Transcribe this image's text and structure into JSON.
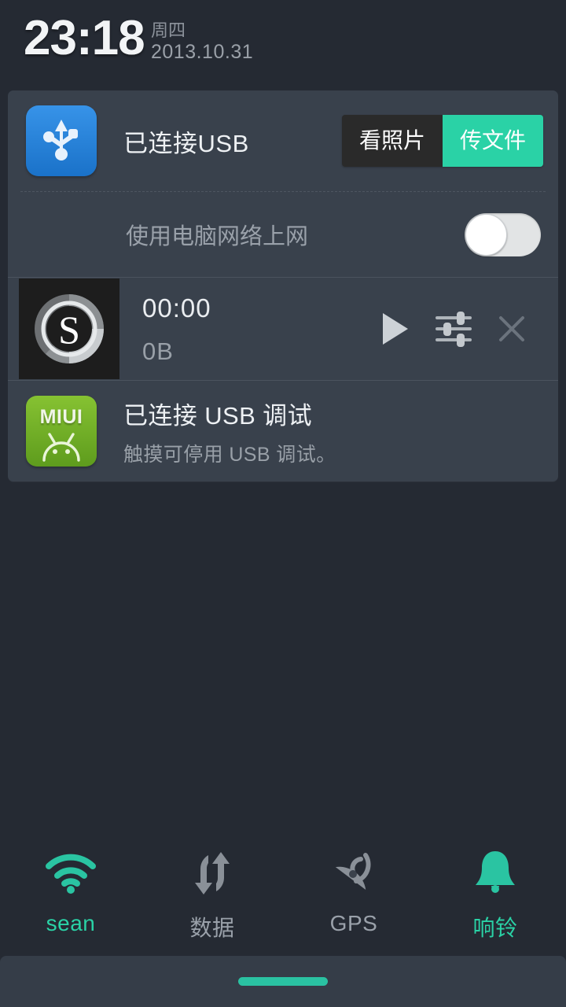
{
  "statusbar": {
    "time": "23:18",
    "weekday": "周四",
    "date": "2013.10.31"
  },
  "panel": {
    "usb": {
      "icon": "usb-icon",
      "title": "已连接USB",
      "buttons": [
        {
          "label": "看照片",
          "selected": false
        },
        {
          "label": "传文件",
          "selected": true
        }
      ]
    },
    "tether": {
      "label": "使用电脑网络上网",
      "toggle_state": "off"
    },
    "recorder": {
      "icon": "recorder-s-logo",
      "time": "00:00",
      "size": "0B",
      "actions": [
        "play-icon",
        "equalizer-icon",
        "close-icon"
      ]
    },
    "miui": {
      "icon": "miui-android-icon",
      "icon_word": "MIUI",
      "title": "已连接 USB 调试",
      "subtitle": "触摸可停用 USB 调试。"
    }
  },
  "quick_toggles": [
    {
      "name": "wifi",
      "icon": "wifi-icon",
      "label": "sean",
      "state": "on"
    },
    {
      "name": "data",
      "icon": "data-sync-icon",
      "label": "数据",
      "state": "off"
    },
    {
      "name": "gps",
      "icon": "gps-icon",
      "label": "GPS",
      "state": "off"
    },
    {
      "name": "ring",
      "icon": "bell-icon",
      "label": "响铃",
      "state": "on"
    }
  ],
  "colors": {
    "accent": "#2ad2a6",
    "panel_bg": "#39414c",
    "screen_bg": "#252a33",
    "usb_icon": "#2e86dd",
    "miui_icon": "#73ad28",
    "inactive": "#9aa1aa"
  }
}
